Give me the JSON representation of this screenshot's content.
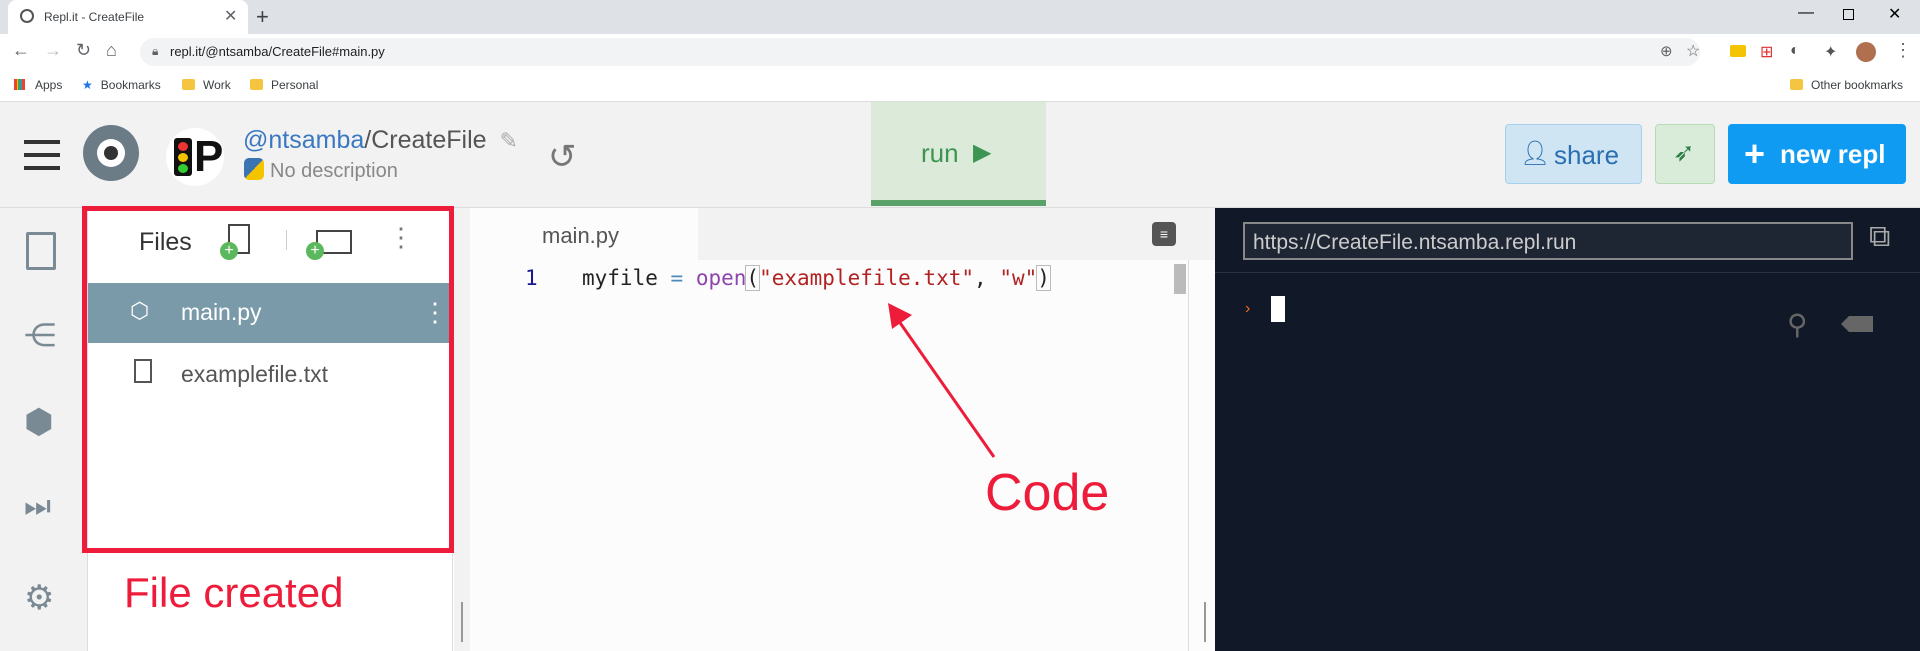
{
  "browser": {
    "tab_title": "Repl.it - CreateFile",
    "url": "repl.it/@ntsamba/CreateFile#main.py",
    "bookmarks": [
      "Apps",
      "Bookmarks",
      "Work",
      "Personal"
    ],
    "other_bookmarks": "Other bookmarks"
  },
  "header": {
    "owner": "@ntsamba",
    "separator": "/",
    "repl_name": "CreateFile",
    "description": "No description",
    "run_label": "run",
    "share_label": "share",
    "new_repl_label": "new repl"
  },
  "files": {
    "title": "Files",
    "items": [
      {
        "name": "main.py",
        "active": true
      },
      {
        "name": "examplefile.txt",
        "active": false
      }
    ]
  },
  "editor": {
    "tab": "main.py",
    "lines": [
      {
        "num": "1",
        "var": "myfile",
        "op": "=",
        "fn": "open",
        "arg1": "\"examplefile.txt\"",
        "comma": ",",
        "arg2": "\"w\""
      }
    ]
  },
  "console": {
    "url": "https://CreateFile.ntsamba.repl.run"
  },
  "annotations": {
    "file_created": "File created",
    "code": "Code"
  },
  "colors": {
    "annotation_red": "#ee1c3b",
    "run_green": "#3c9552",
    "new_repl_blue": "#0f9bf2",
    "console_bg": "#111827",
    "file_active_bg": "#7a9aaa"
  }
}
